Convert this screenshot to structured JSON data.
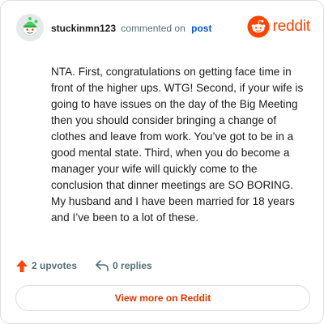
{
  "comment": {
    "username": "stuckinmn123",
    "action_text": "commented on",
    "post_link": "post",
    "body": "NTA. First, congratulations on getting face time in front of the higher ups. WTG! Second, if your wife is going to have issues on the day of the Big Meeting then you should consider bringing a change of clothes and leave from work. You’ve got to be in a good mental state. Third, when you do become a manager your wife will quickly come to the conclusion that dinner meetings are SO BORING. My husband and I have been married for 18 years and I’ve been to a lot of these."
  },
  "brand": {
    "name": "reddit",
    "color": "#ff4500",
    "icon": "reddit-logo-icon"
  },
  "actions": {
    "upvotes": "2 upvotes",
    "replies": "0 replies",
    "upvote_color": "#ff4500"
  },
  "footer": {
    "view_more_label": "View more on Reddit"
  }
}
